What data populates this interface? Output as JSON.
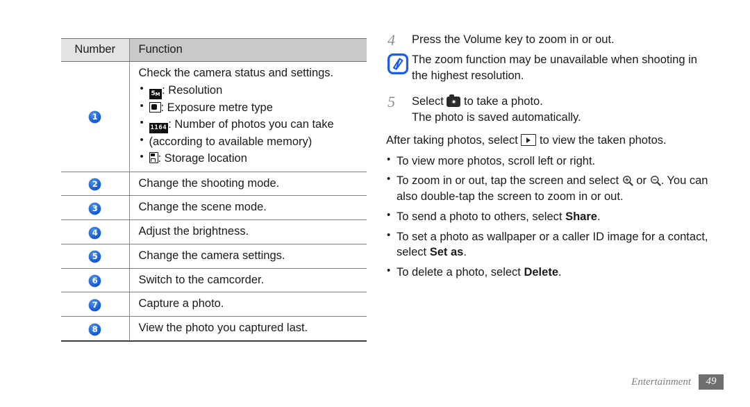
{
  "page": {
    "footer_label": "Entertainment",
    "footer_page": "49"
  },
  "table": {
    "headers": {
      "number": "Number",
      "function": "Function"
    },
    "rows": [
      {
        "number": "1",
        "title": "Check the camera status and settings.",
        "items": [
          {
            "icon": "resolution-icon",
            "icon_text": "5",
            "icon_sub": "M",
            "text": ": Resolution"
          },
          {
            "icon": "exposure-metre-icon",
            "text": ": Exposure metre type"
          },
          {
            "icon": "photo-count-icon",
            "icon_text": "1164",
            "text": ": Number of photos you can take"
          },
          {
            "icon": "none",
            "text": "(according to available memory)"
          },
          {
            "icon": "storage-location-icon",
            "text": ": Storage location"
          }
        ]
      },
      {
        "number": "2",
        "title": "Change the shooting mode."
      },
      {
        "number": "3",
        "title": "Change the scene mode."
      },
      {
        "number": "4",
        "title": "Adjust the brightness."
      },
      {
        "number": "5",
        "title": "Change the camera settings."
      },
      {
        "number": "6",
        "title": "Switch to the camcorder."
      },
      {
        "number": "7",
        "title": "Capture a photo."
      },
      {
        "number": "8",
        "title": "View the photo you captured last."
      }
    ]
  },
  "steps": {
    "step4": {
      "number": "4",
      "text": "Press the Volume key to zoom in or out."
    },
    "note": {
      "icon": "note-pen-icon",
      "text": "The zoom function may be unavailable when shooting in the highest resolution."
    },
    "step5": {
      "number": "5",
      "text_before": "Select",
      "icon": "camera-icon",
      "text_after": "to take a photo.",
      "sub_text": "The photo is saved automatically."
    }
  },
  "after_photos": {
    "text_before": "After taking photos, select",
    "icon": "play-view-icon",
    "text_after": "to view the taken photos.",
    "bullets": [
      {
        "parts": [
          {
            "type": "text",
            "value": "To view more photos, scroll left or right."
          }
        ]
      },
      {
        "parts": [
          {
            "type": "text",
            "value": "To zoom in or out, tap the screen and select"
          },
          {
            "type": "icon",
            "value": "zoom-in-icon"
          },
          {
            "type": "text",
            "value": "or"
          },
          {
            "type": "icon",
            "value": "zoom-out-icon"
          },
          {
            "type": "text",
            "value": ". You can also double-tap the screen to zoom in or out."
          }
        ]
      },
      {
        "parts": [
          {
            "type": "text",
            "value": "To send a photo to others, select"
          },
          {
            "type": "bold",
            "value": "Share"
          },
          {
            "type": "text",
            "value": "."
          }
        ]
      },
      {
        "parts": [
          {
            "type": "text",
            "value": "To set a photo as wallpaper or a caller ID image for a contact, select"
          },
          {
            "type": "bold",
            "value": "Set as"
          },
          {
            "type": "text",
            "value": "."
          }
        ]
      },
      {
        "parts": [
          {
            "type": "text",
            "value": "To delete a photo, select"
          },
          {
            "type": "bold",
            "value": "Delete"
          },
          {
            "type": "text",
            "value": "."
          }
        ]
      }
    ]
  },
  "colors": {
    "badge_blue": "#1565d8",
    "note_blue": "#1b5fe8",
    "header_number_bg": "#e3e3e3",
    "header_function_bg": "#c9c9c9",
    "footer_gray": "#6f6f6f"
  }
}
